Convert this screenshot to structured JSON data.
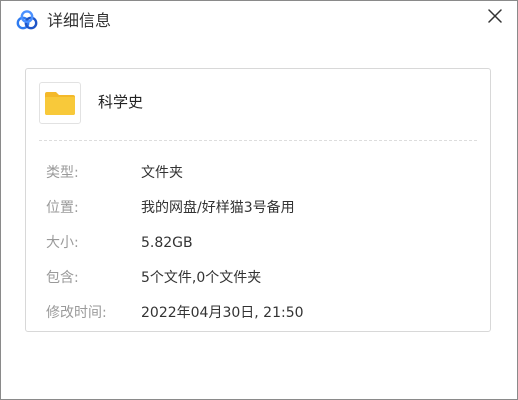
{
  "window": {
    "title": "详细信息",
    "app_icon": "cloud-logo-icon",
    "close_icon": "close-icon"
  },
  "file": {
    "icon": "folder-icon",
    "name": "科学史"
  },
  "details": {
    "type_label": "类型:",
    "type_value": "文件夹",
    "location_label": "位置:",
    "location_value": "我的网盘/好样猫3号备用",
    "size_label": "大小:",
    "size_value": "5.82GB",
    "contains_label": "包含:",
    "contains_value": "5个文件,0个文件夹",
    "modified_label": "修改时间:",
    "modified_value": "2022年04月30日, 21:50"
  },
  "colors": {
    "logo_blue": "#2f7bf0",
    "logo_dark": "#1f56c8",
    "folder_yellow": "#f8c93a",
    "folder_tab": "#f4b92a"
  }
}
